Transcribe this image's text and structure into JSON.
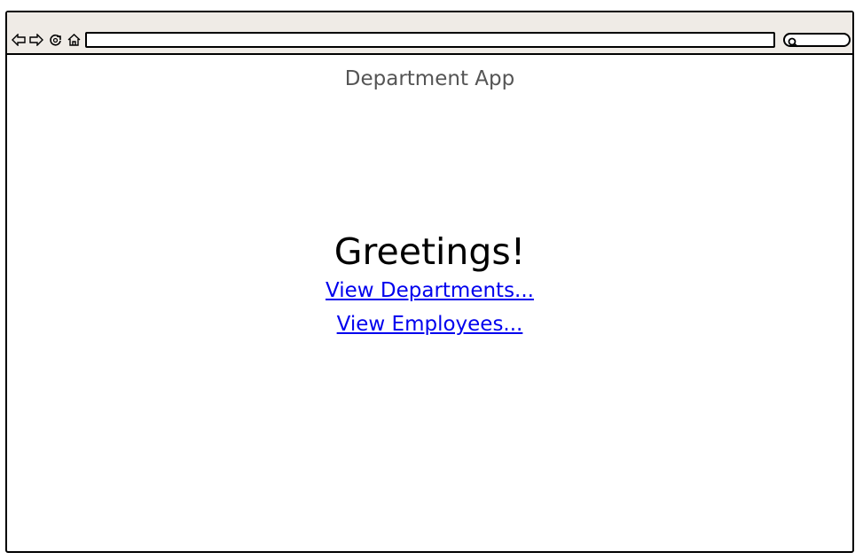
{
  "browser": {
    "address": "",
    "icons": [
      "back-icon",
      "forward-icon",
      "reload-icon",
      "home-icon",
      "search-icon"
    ]
  },
  "page": {
    "title": "Department App",
    "greeting": "Greetings!",
    "links": [
      {
        "label": "View Departments..."
      },
      {
        "label": "View Employees..."
      }
    ]
  },
  "colors": {
    "toolbar": "#efebe6",
    "link": "#0000ee",
    "title": "#555555"
  }
}
